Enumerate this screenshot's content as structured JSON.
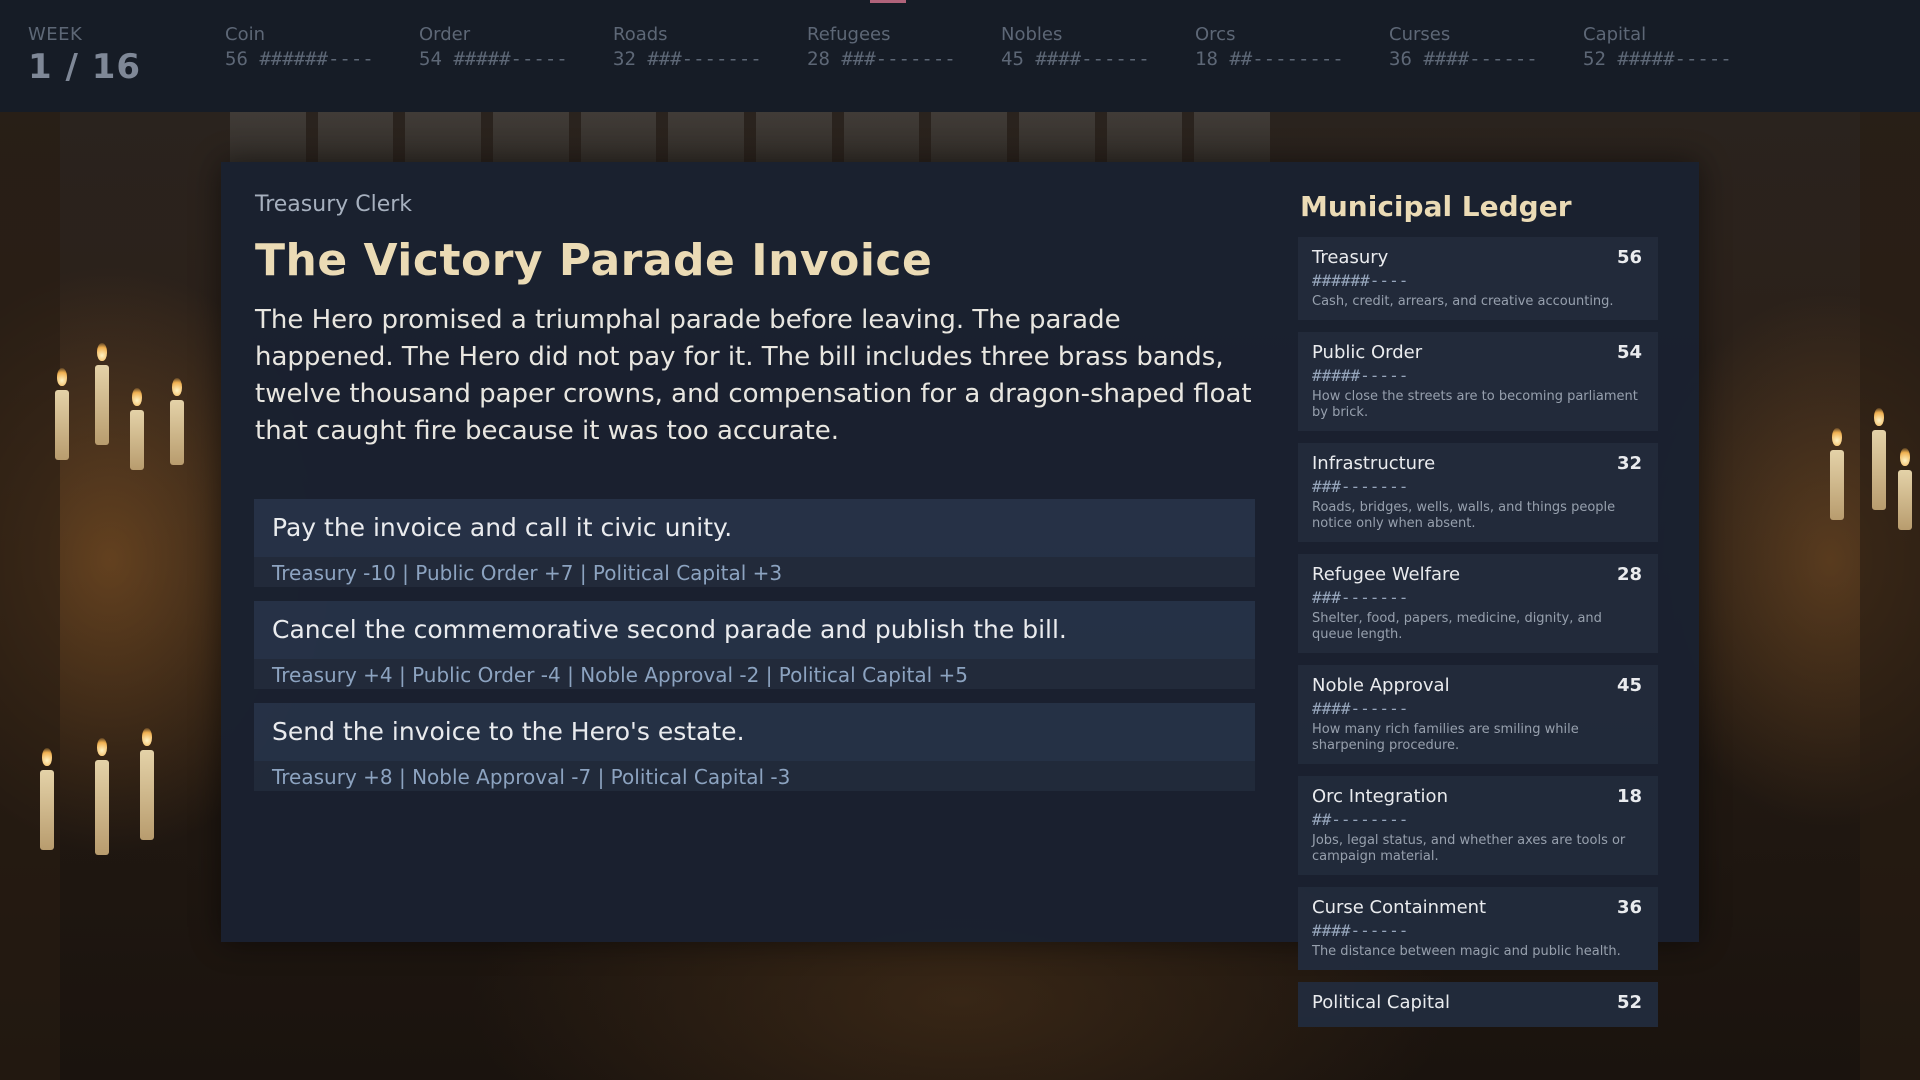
{
  "week": {
    "label": "WEEK",
    "value": "1 / 16"
  },
  "stats": [
    {
      "label": "Coin",
      "line": "56 ######----"
    },
    {
      "label": "Order",
      "line": "54 #####-----"
    },
    {
      "label": "Roads",
      "line": "32 ###-------"
    },
    {
      "label": "Refugees",
      "line": "28 ###-------"
    },
    {
      "label": "Nobles",
      "line": "45 ####------"
    },
    {
      "label": "Orcs",
      "line": "18 ##--------"
    },
    {
      "label": "Curses",
      "line": "36 ####------"
    },
    {
      "label": "Capital",
      "line": "52 #####-----"
    }
  ],
  "event": {
    "speaker": "Treasury Clerk",
    "title": "The Victory Parade Invoice",
    "description": "The Hero promised a triumphal parade before leaving. The parade happened. The Hero did not pay for it. The bill includes three brass bands, twelve thousand paper crowns, and compensation for a dragon-shaped float that caught fire because it was too accurate."
  },
  "choices": [
    {
      "label": "Pay the invoice and call it civic unity.",
      "effects": "Treasury -10 | Public Order +7 | Political Capital +3"
    },
    {
      "label": "Cancel the commemorative second parade and publish the bill.",
      "effects": "Treasury +4 | Public Order -4 | Noble Approval -2 | Political Capital +5"
    },
    {
      "label": "Send the invoice to the Hero's estate.",
      "effects": "Treasury +8 | Noble Approval -7 | Political Capital -3"
    }
  ],
  "ledger": {
    "title": "Municipal Ledger",
    "items": [
      {
        "name": "Treasury",
        "value": "56",
        "bar": "######----",
        "note": "Cash, credit, arrears, and creative accounting."
      },
      {
        "name": "Public Order",
        "value": "54",
        "bar": "#####-----",
        "note": "How close the streets are to becoming parliament by brick."
      },
      {
        "name": "Infrastructure",
        "value": "32",
        "bar": "###-------",
        "note": "Roads, bridges, wells, walls, and things people notice only when absent."
      },
      {
        "name": "Refugee Welfare",
        "value": "28",
        "bar": "###-------",
        "note": "Shelter, food, papers, medicine, dignity, and queue length."
      },
      {
        "name": "Noble Approval",
        "value": "45",
        "bar": "####------",
        "note": "How many rich families are smiling while sharpening procedure."
      },
      {
        "name": "Orc Integration",
        "value": "18",
        "bar": "##--------",
        "note": "Jobs, legal status, and whether axes are tools or campaign material."
      },
      {
        "name": "Curse Containment",
        "value": "36",
        "bar": "####------",
        "note": "The distance between magic and public health."
      },
      {
        "name": "Political Capital",
        "value": "52",
        "bar": "",
        "note": ""
      }
    ]
  }
}
